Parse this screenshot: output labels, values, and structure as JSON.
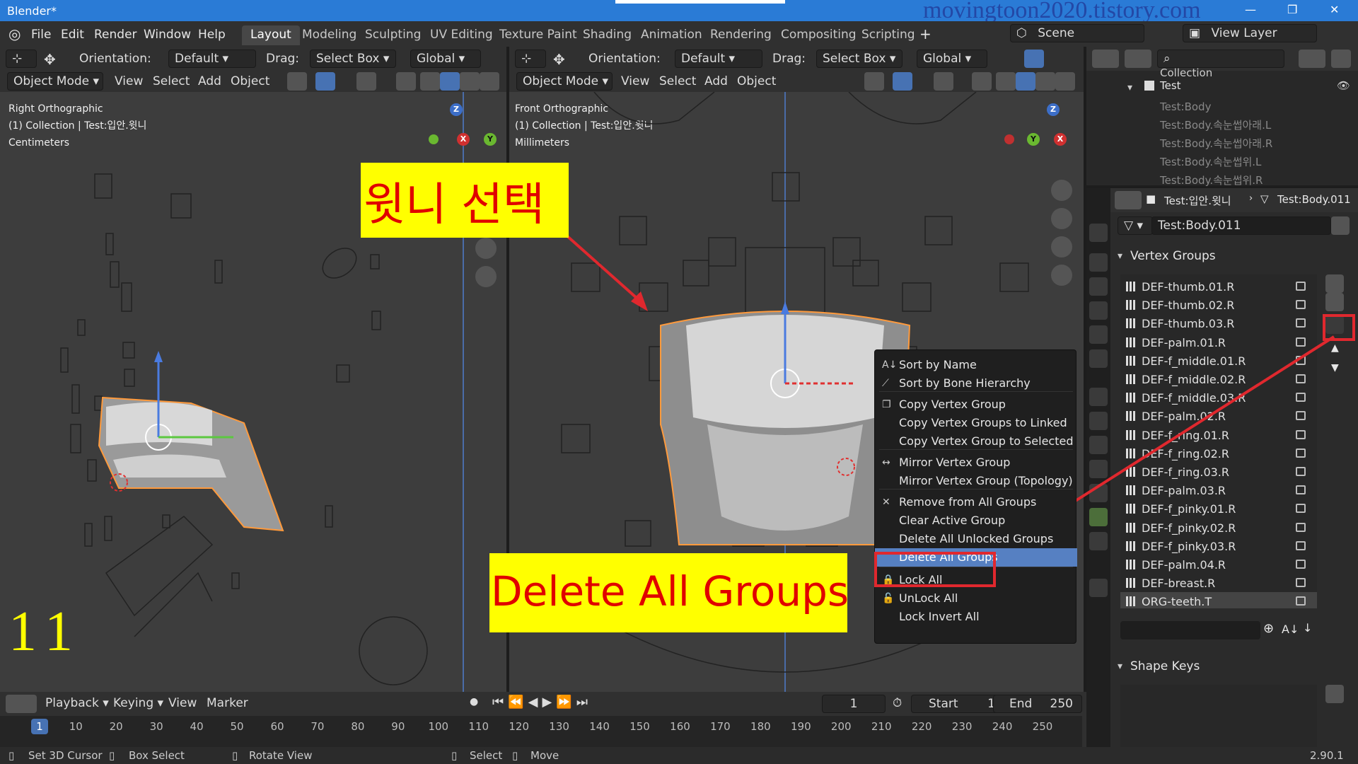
{
  "window": {
    "title": "Blender*",
    "watermark": "movingtoon2020.tistory.com"
  },
  "menu": [
    "File",
    "Edit",
    "Render",
    "Window",
    "Help"
  ],
  "workspaces": [
    "Layout",
    "Modeling",
    "Sculpting",
    "UV Editing",
    "Texture Paint",
    "Shading",
    "Animation",
    "Rendering",
    "Compositing",
    "Scripting"
  ],
  "scene": {
    "scene": "Scene",
    "view_layer": "View Layer"
  },
  "viewport_header": {
    "orientation_label": "Orientation:",
    "orientation_value": "Default",
    "drag_label": "Drag:",
    "drag_value": "Select Box",
    "transform": "Global",
    "mode": "Object Mode",
    "menus": [
      "View",
      "Select",
      "Add",
      "Object"
    ]
  },
  "left_view": {
    "title": "Right Orthographic",
    "collection": "(1) Collection | Test:입안.윗니",
    "units": "Centimeters",
    "step": "11"
  },
  "right_view": {
    "title": "Front Orthographic",
    "collection": "(1) Collection | Test:입안.윗니",
    "units": "Millimeters"
  },
  "annotations": {
    "select_teeth": "윗니 선택",
    "delete_all": "Delete All Groups"
  },
  "outliner": {
    "collection": "Collection",
    "test": "Test",
    "items": [
      "Test:Body",
      "Test:Body.속눈썹아래.L",
      "Test:Body.속눈썹아래.R",
      "Test:Body.속눈썹위.L",
      "Test:Body.속눈썹위.R"
    ]
  },
  "properties": {
    "breadcrumb_obj": "Test:입안.윗니",
    "breadcrumb_mesh": "Test:Body.011",
    "mesh_name": "Test:Body.011",
    "vertex_groups_title": "Vertex Groups",
    "vertex_groups": [
      "DEF-thumb.01.R",
      "DEF-thumb.02.R",
      "DEF-thumb.03.R",
      "DEF-palm.01.R",
      "DEF-f_middle.01.R",
      "DEF-f_middle.02.R",
      "DEF-f_middle.03.R",
      "DEF-palm.02.R",
      "DEF-f_ring.01.R",
      "DEF-f_ring.02.R",
      "DEF-f_ring.03.R",
      "DEF-palm.03.R",
      "DEF-f_pinky.01.R",
      "DEF-f_pinky.02.R",
      "DEF-f_pinky.03.R",
      "DEF-palm.04.R",
      "DEF-breast.R",
      "ORG-teeth.T"
    ],
    "shape_keys_title": "Shape Keys"
  },
  "context_menu": [
    {
      "label": "Sort by Name",
      "icon": "sort-alpha-icon",
      "glyph": "A↓"
    },
    {
      "label": "Sort by Bone Hierarchy",
      "icon": "bone-icon",
      "glyph": "⟋"
    },
    {
      "label": "Copy Vertex Group",
      "icon": "copy-icon",
      "glyph": "❐"
    },
    {
      "label": "Copy Vertex Groups to Linked",
      "icon": "",
      "glyph": ""
    },
    {
      "label": "Copy Vertex Group to Selected",
      "icon": "",
      "glyph": ""
    },
    {
      "label": "Mirror Vertex Group",
      "icon": "mirror-icon",
      "glyph": "↔"
    },
    {
      "label": "Mirror Vertex Group (Topology)",
      "icon": "",
      "glyph": ""
    },
    {
      "label": "Remove from All Groups",
      "icon": "x-icon",
      "glyph": "✕"
    },
    {
      "label": "Clear Active Group",
      "icon": "",
      "glyph": ""
    },
    {
      "label": "Delete All Unlocked Groups",
      "icon": "",
      "glyph": ""
    },
    {
      "label": "Delete All Groups",
      "icon": "",
      "glyph": ""
    },
    {
      "label": "Lock All",
      "icon": "lock-icon",
      "glyph": "🔒"
    },
    {
      "label": "UnLock All",
      "icon": "unlock-icon",
      "glyph": "🔓"
    },
    {
      "label": "Lock Invert All",
      "icon": "",
      "glyph": ""
    }
  ],
  "timeline": {
    "menus": [
      "Playback",
      "Keying",
      "View",
      "Marker"
    ],
    "current_frame": "1",
    "start_label": "Start",
    "start": "1",
    "end_label": "End",
    "end": "250",
    "ticks": [
      "1",
      "10",
      "20",
      "30",
      "40",
      "50",
      "60",
      "70",
      "80",
      "90",
      "100",
      "110",
      "120",
      "130",
      "140",
      "150",
      "160",
      "170",
      "180",
      "190",
      "200",
      "210",
      "220",
      "230",
      "240",
      "250"
    ]
  },
  "statusbar": {
    "set_cursor": "Set 3D Cursor",
    "box_select": "Box Select",
    "rotate_view": "Rotate View",
    "select": "Select",
    "move": "Move",
    "version": "2.90.1"
  },
  "colors": {
    "accent": "#4772b3",
    "highlight": "#5680c2",
    "annotation_bg": "#ffff00",
    "annotation_fg": "#e00000",
    "red_box": "#e0282e"
  }
}
